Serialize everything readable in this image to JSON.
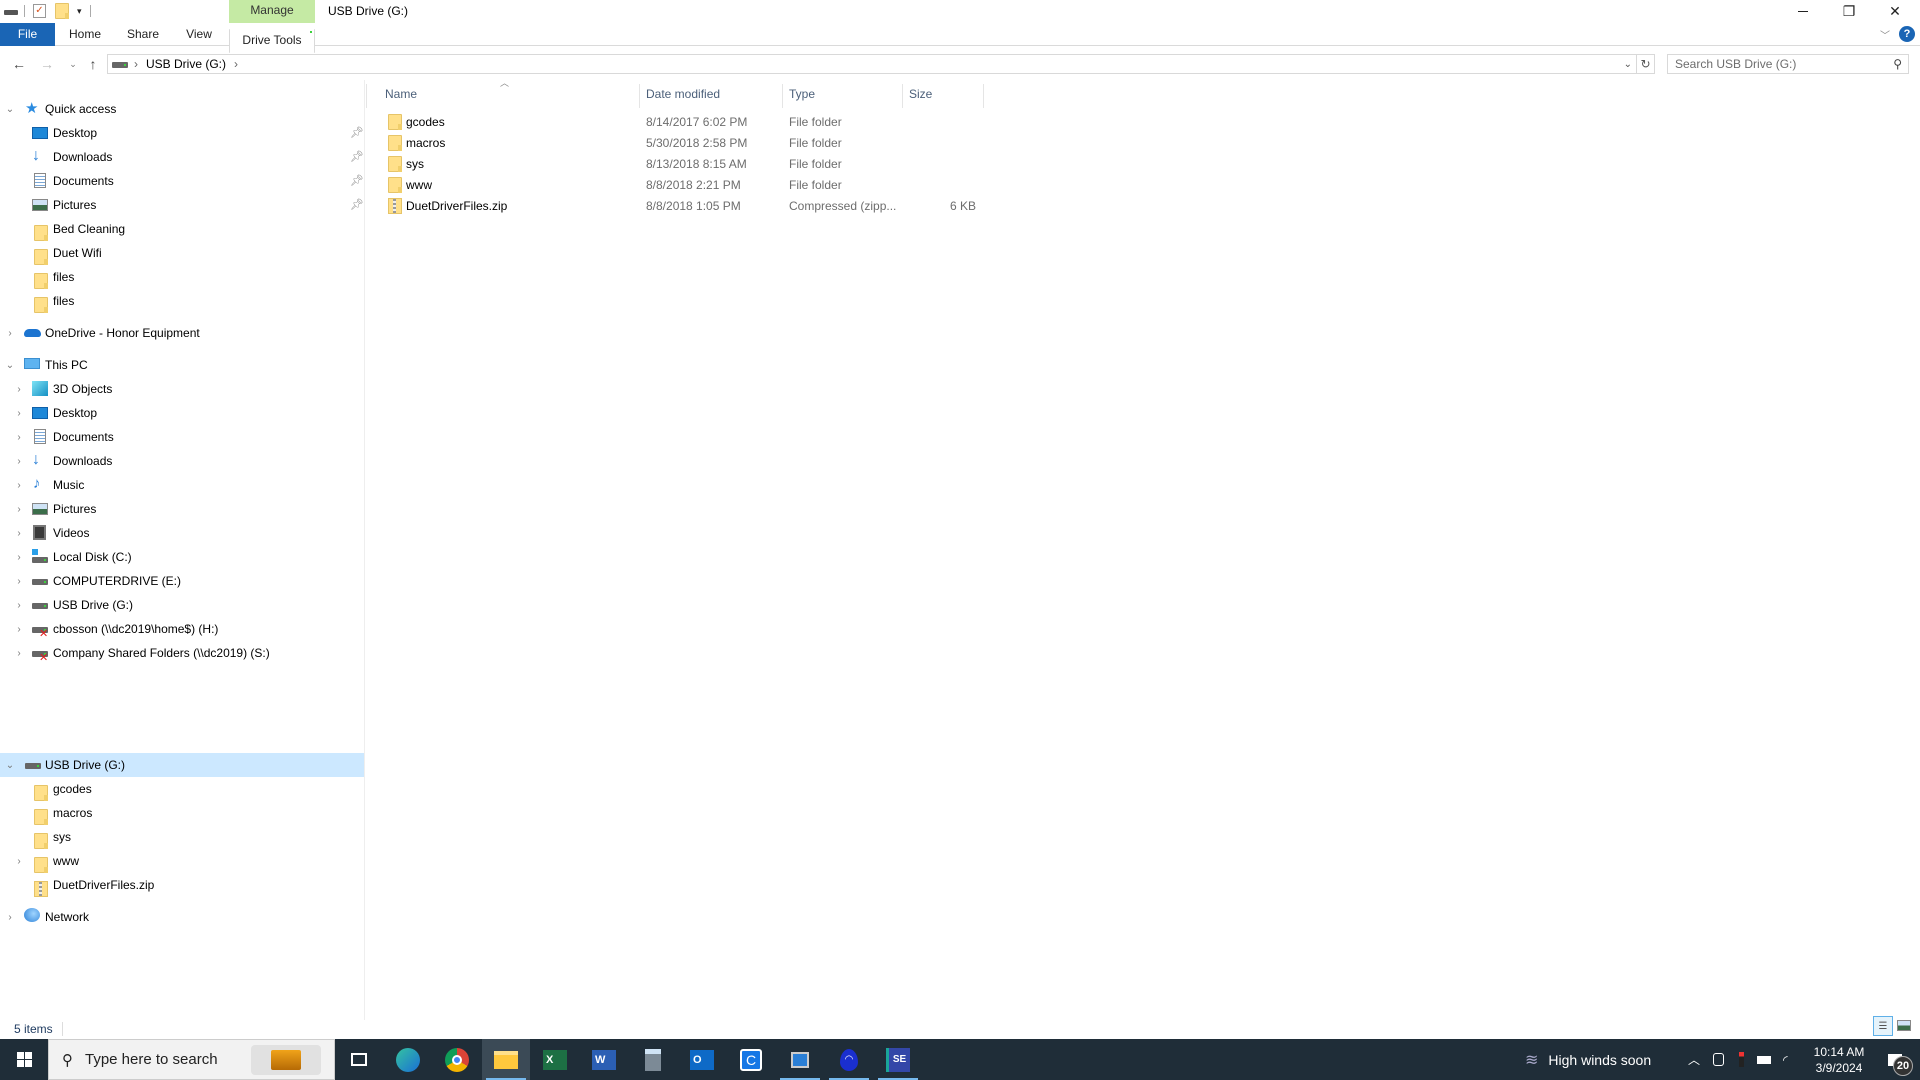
{
  "window": {
    "title": "USB Drive (G:)",
    "context_tab": "Manage",
    "controls": {
      "minimize": "—",
      "restore": "❐",
      "close": "✕"
    }
  },
  "quick_access_toolbar": {
    "icons": [
      "drive-icon",
      "properties-icon",
      "new-folder-icon",
      "customize-dropdown-icon"
    ]
  },
  "ribbon": {
    "tabs": [
      {
        "label": "File"
      },
      {
        "label": "Home"
      },
      {
        "label": "Share"
      },
      {
        "label": "View"
      },
      {
        "label": "Drive Tools"
      }
    ],
    "help_label": "?"
  },
  "address_bar": {
    "path": [
      "USB Drive (G:)"
    ],
    "separator": "›",
    "search_placeholder": "Search USB Drive (G:)"
  },
  "nav_pane": {
    "quick_access": {
      "label": "Quick access",
      "items": [
        {
          "label": "Desktop",
          "icon": "desktop",
          "pinned": true
        },
        {
          "label": "Downloads",
          "icon": "downloads",
          "pinned": true
        },
        {
          "label": "Documents",
          "icon": "documents",
          "pinned": true
        },
        {
          "label": "Pictures",
          "icon": "pictures",
          "pinned": true
        },
        {
          "label": "Bed Cleaning",
          "icon": "folder",
          "pinned": false
        },
        {
          "label": "Duet Wifi",
          "icon": "folder",
          "pinned": false
        },
        {
          "label": "files",
          "icon": "folder",
          "pinned": false
        },
        {
          "label": "files",
          "icon": "folder",
          "pinned": false
        }
      ]
    },
    "onedrive": {
      "label": "OneDrive - Honor Equipment"
    },
    "this_pc": {
      "label": "This PC",
      "items": [
        {
          "label": "3D Objects",
          "icon": "3d-objects"
        },
        {
          "label": "Desktop",
          "icon": "desktop"
        },
        {
          "label": "Documents",
          "icon": "documents"
        },
        {
          "label": "Downloads",
          "icon": "downloads"
        },
        {
          "label": "Music",
          "icon": "music"
        },
        {
          "label": "Pictures",
          "icon": "pictures"
        },
        {
          "label": "Videos",
          "icon": "videos"
        },
        {
          "label": "Local Disk (C:)",
          "icon": "local-disk"
        },
        {
          "label": "COMPUTERDRIVE (E:)",
          "icon": "drive"
        },
        {
          "label": "USB Drive (G:)",
          "icon": "drive"
        },
        {
          "label": "cbosson (\\\\dc2019\\home$) (H:)",
          "icon": "network-drive-disconnected"
        },
        {
          "label": "Company Shared Folders (\\\\dc2019) (S:)",
          "icon": "network-drive-disconnected"
        }
      ]
    },
    "usb_drive": {
      "label": "USB Drive (G:)",
      "selected": true,
      "items": [
        {
          "label": "gcodes",
          "icon": "folder",
          "expandable": false
        },
        {
          "label": "macros",
          "icon": "folder",
          "expandable": false
        },
        {
          "label": "sys",
          "icon": "folder",
          "expandable": false
        },
        {
          "label": "www",
          "icon": "folder",
          "expandable": true
        },
        {
          "label": "DuetDriverFiles.zip",
          "icon": "zip",
          "expandable": false
        }
      ]
    },
    "network": {
      "label": "Network"
    }
  },
  "file_list": {
    "columns": [
      {
        "label": "Name",
        "sorted": "ascending"
      },
      {
        "label": "Date modified"
      },
      {
        "label": "Type"
      },
      {
        "label": "Size"
      }
    ],
    "rows": [
      {
        "name": "gcodes",
        "date": "8/14/2017 6:02 PM",
        "type": "File folder",
        "size": "",
        "icon": "folder"
      },
      {
        "name": "macros",
        "date": "5/30/2018 2:58 PM",
        "type": "File folder",
        "size": "",
        "icon": "folder"
      },
      {
        "name": "sys",
        "date": "8/13/2018 8:15 AM",
        "type": "File folder",
        "size": "",
        "icon": "folder"
      },
      {
        "name": "www",
        "date": "8/8/2018 2:21 PM",
        "type": "File folder",
        "size": "",
        "icon": "folder"
      },
      {
        "name": "DuetDriverFiles.zip",
        "date": "8/8/2018 1:05 PM",
        "type": "Compressed (zipp...",
        "size": "6 KB",
        "icon": "zip"
      }
    ]
  },
  "status_bar": {
    "item_count": "5 items",
    "views": [
      "details-view",
      "large-icons-view"
    ]
  },
  "taskbar": {
    "search_placeholder": "Type here to search",
    "apps": [
      {
        "name": "task-view"
      },
      {
        "name": "edge"
      },
      {
        "name": "chrome"
      },
      {
        "name": "file-explorer",
        "active": true
      },
      {
        "name": "excel"
      },
      {
        "name": "word"
      },
      {
        "name": "calculator"
      },
      {
        "name": "outlook"
      },
      {
        "name": "c-app"
      },
      {
        "name": "remote-desktop",
        "running": true
      },
      {
        "name": "wifi-app",
        "running": true
      },
      {
        "name": "se-app",
        "running": true
      }
    ],
    "weather": "High winds soon",
    "time": "10:14 AM",
    "date": "3/9/2024",
    "notifications": "20"
  },
  "colors": {
    "accent": "#1a65b5",
    "manage_tab": "#c5eaa4",
    "selection": "#cce8ff",
    "taskbar": "#1f2d38",
    "header_text": "#4c607a"
  }
}
